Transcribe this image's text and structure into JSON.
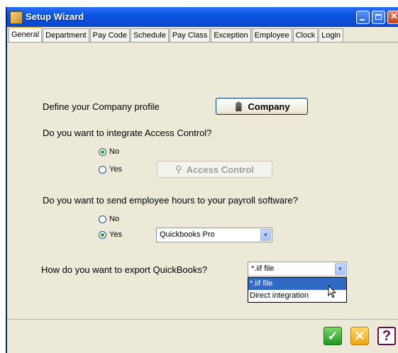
{
  "window": {
    "title": "Setup Wizard"
  },
  "tabs": [
    {
      "label": "General",
      "active": true
    },
    {
      "label": "Department",
      "active": false
    },
    {
      "label": "Pay Code",
      "active": false
    },
    {
      "label": "Schedule",
      "active": false
    },
    {
      "label": "Pay Class",
      "active": false
    },
    {
      "label": "Exception",
      "active": false
    },
    {
      "label": "Employee",
      "active": false
    },
    {
      "label": "Clock",
      "active": false
    },
    {
      "label": "Login",
      "active": false
    }
  ],
  "company": {
    "prompt": "Define your Company profile",
    "button_label": "Company",
    "icon": "building-icon"
  },
  "access_control": {
    "question": "Do you want to integrate Access Control?",
    "options": [
      {
        "label": "No",
        "selected": true
      },
      {
        "label": "Yes",
        "selected": false
      }
    ],
    "button_label": "Access Control",
    "button_enabled": false,
    "icon": "key-icon"
  },
  "payroll": {
    "question": "Do you want to send employee hours to your payroll software?",
    "options": [
      {
        "label": "No",
        "selected": false
      },
      {
        "label": "Yes",
        "selected": true
      }
    ],
    "software_selected": "Quickbooks Pro"
  },
  "export": {
    "question": "How do you want to export QuickBooks?",
    "selected": "*.iif file",
    "options": [
      "*.iif file",
      "Direct integration"
    ],
    "dropdown_open": true
  },
  "footer": {
    "ok_icon": "checkmark-icon",
    "cancel_icon": "x-icon",
    "help_icon": "question-icon"
  },
  "colors": {
    "title_bar": "#0c55e0",
    "panel_bg": "#ece9d8",
    "selection": "#316ac5",
    "radio_selected": "#21a121"
  }
}
